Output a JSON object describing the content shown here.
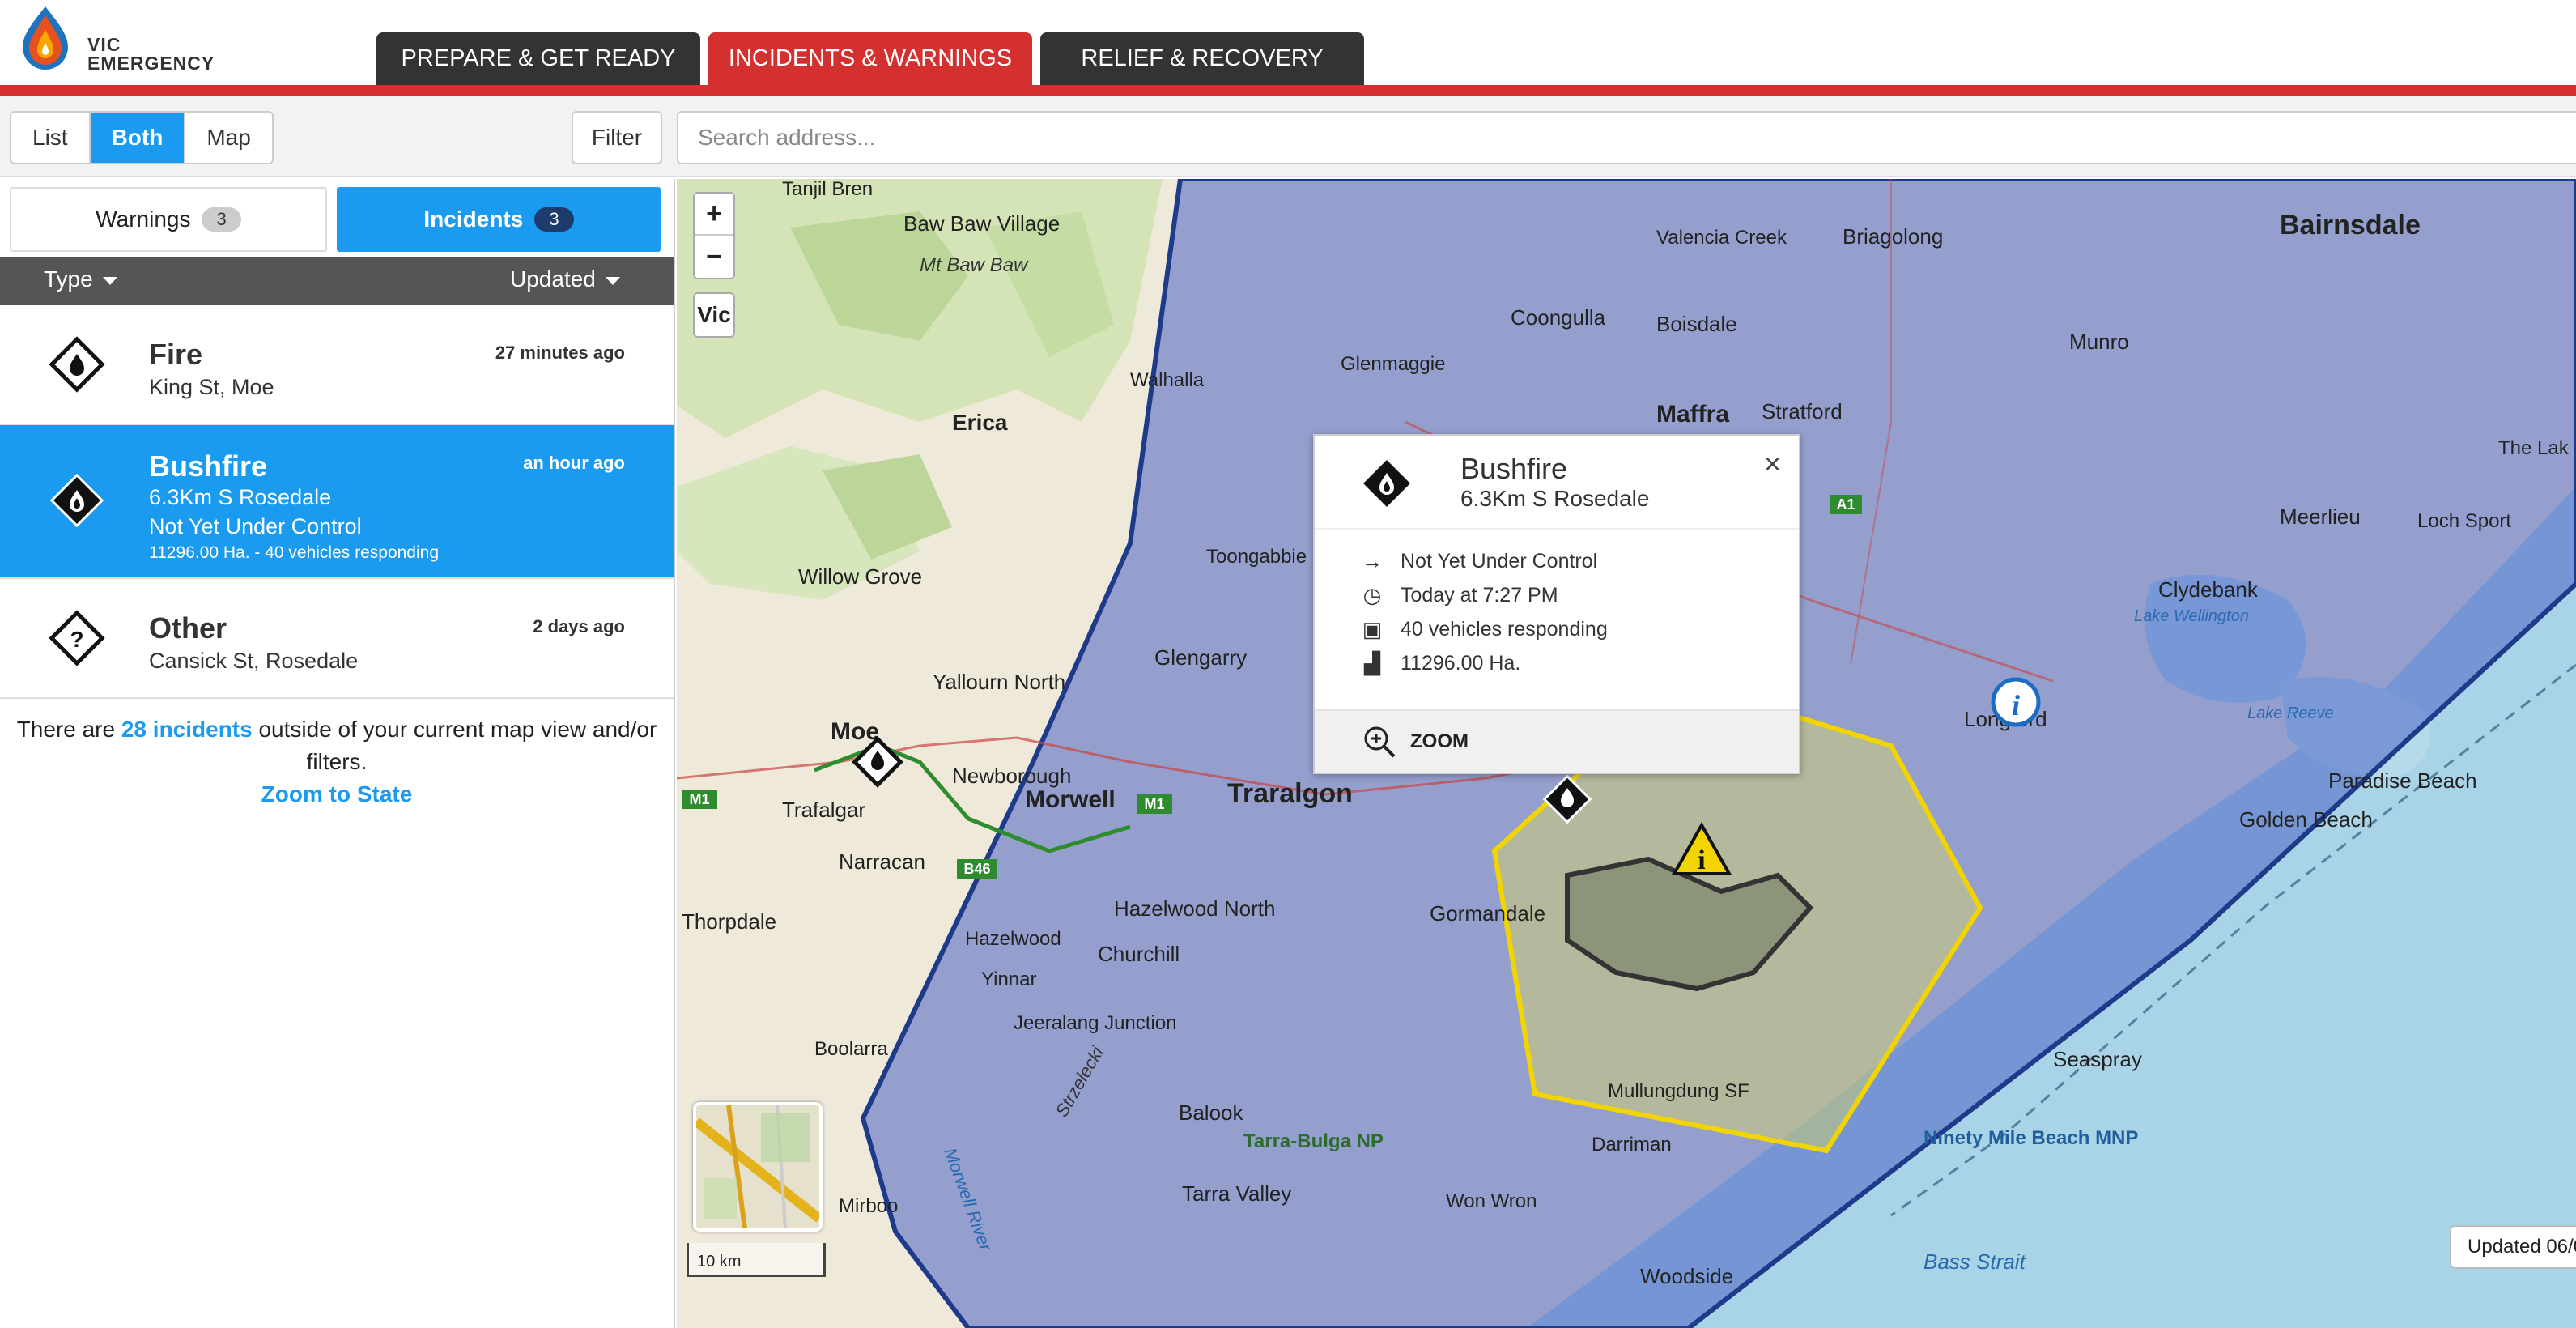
{
  "brand": {
    "line1": "VIC",
    "line2": "EMERGENCY"
  },
  "nav": {
    "tabs": [
      {
        "label": "PREPARE & GET READY"
      },
      {
        "label": "INCIDENTS & WARNINGS"
      },
      {
        "label": "RELIEF & RECOVERY"
      }
    ],
    "active": "INCIDENTS & WARNINGS"
  },
  "toolbar": {
    "view": {
      "list": "List",
      "both": "Both",
      "map": "Map",
      "active": "Both"
    },
    "filter_label": "Filter",
    "search_placeholder": "Search address..."
  },
  "panel": {
    "warnings": {
      "label": "Warnings",
      "count": "3"
    },
    "incidents": {
      "label": "Incidents",
      "count": "3"
    },
    "sort": {
      "type": "Type",
      "updated": "Updated"
    },
    "items": [
      {
        "title": "Fire",
        "time": "27 minutes ago",
        "location": "King St, Moe"
      },
      {
        "title": "Bushfire",
        "time": "an hour ago",
        "location": "6.3Km S Rosedale",
        "status": "Not Yet Under Control",
        "detail": "11296.00 Ha. - 40 vehicles responding"
      },
      {
        "title": "Other",
        "time": "2 days ago",
        "location": "Cansick St, Rosedale"
      }
    ],
    "note": {
      "before": "There are ",
      "link": "28 incidents",
      "after": " outside of your current map view and/or filters.",
      "zoom": "Zoom to State"
    }
  },
  "map": {
    "zoom_in": "+",
    "zoom_out": "−",
    "vic": "Vic",
    "scale": "10 km",
    "updated": "Updated 06/0",
    "labels": {
      "bairnsdale": "Bairnsdale",
      "traralgon": "Traralgon",
      "morwell": "Morwell",
      "moe": "Moe",
      "erica": "Erica",
      "maffra": "Maffra",
      "stratford": "Stratford",
      "briagolong": "Briagolong",
      "trafalgar": "Trafalgar",
      "yallourn_north": "Yallourn North",
      "newborough": "Newborough",
      "churchill": "Churchill",
      "seaspray": "Seaspray",
      "longford": "Longford",
      "gormandale": "Gormandale",
      "willow_grove": "Willow Grove",
      "baw_baw_village": "Baw Baw Village",
      "mt_baw_baw": "Mt Baw Baw",
      "narracan": "Narracan",
      "thorpdale": "Thorpdale",
      "hazelwood_north": "Hazelwood North",
      "glengarry": "Glengarry",
      "coongulla": "Coongulla",
      "boisdale": "Boisdale",
      "valencia_creek": "Valencia Creek",
      "munro": "Munro",
      "meerlieu": "Meerlieu",
      "clydebank": "Clydebank",
      "golden_beach": "Golden Beach",
      "paradise_beach": "Paradise Beach",
      "ninety_mile": "Ninety Mile Beach MNP",
      "bass_strait": "Bass Strait",
      "woodside": "Woodside",
      "balook": "Balook",
      "tarra_valley": "Tarra Valley",
      "tarra_bulga": "Tarra-Bulga NP",
      "mullungdung": "Mullungdung SF",
      "won_wron": "Won Wron",
      "darriman": "Darriman",
      "yinnar": "Yinnar",
      "hazelwood": "Hazelwood",
      "jeeralang": "Jeeralang Junction",
      "boolarra": "Boolarra",
      "mirboo": "Mirboo",
      "glenmaggie": "Glenmaggie",
      "walhalla": "Walhalla",
      "tanjil_bren": "Tanjil Bren",
      "lake_wellington": "Lake Wellington",
      "lake_reeve": "Lake Reeve",
      "loch_sport": "Loch Sport",
      "toongabbie": "Toongabbie",
      "strzelecki": "Strzelecki",
      "morwell_river": "Morwell River",
      "the_lakes": "The Lak",
      "m1": "M1",
      "a1": "A1",
      "b46": "B46"
    }
  },
  "popup": {
    "title": "Bushfire",
    "subtitle": "6.3Km S Rosedale",
    "status": "Not Yet Under Control",
    "time": "Today at 7:27 PM",
    "vehicles": "40 vehicles responding",
    "area": "11296.00 Ha.",
    "zoom": "ZOOM",
    "close": "×"
  },
  "colors": {
    "accent": "#1a9bf0",
    "brand_red": "#d3302f",
    "nav_dark": "#333333",
    "warning_area": "#5a78c8",
    "watch_zone": "#f2d500"
  }
}
